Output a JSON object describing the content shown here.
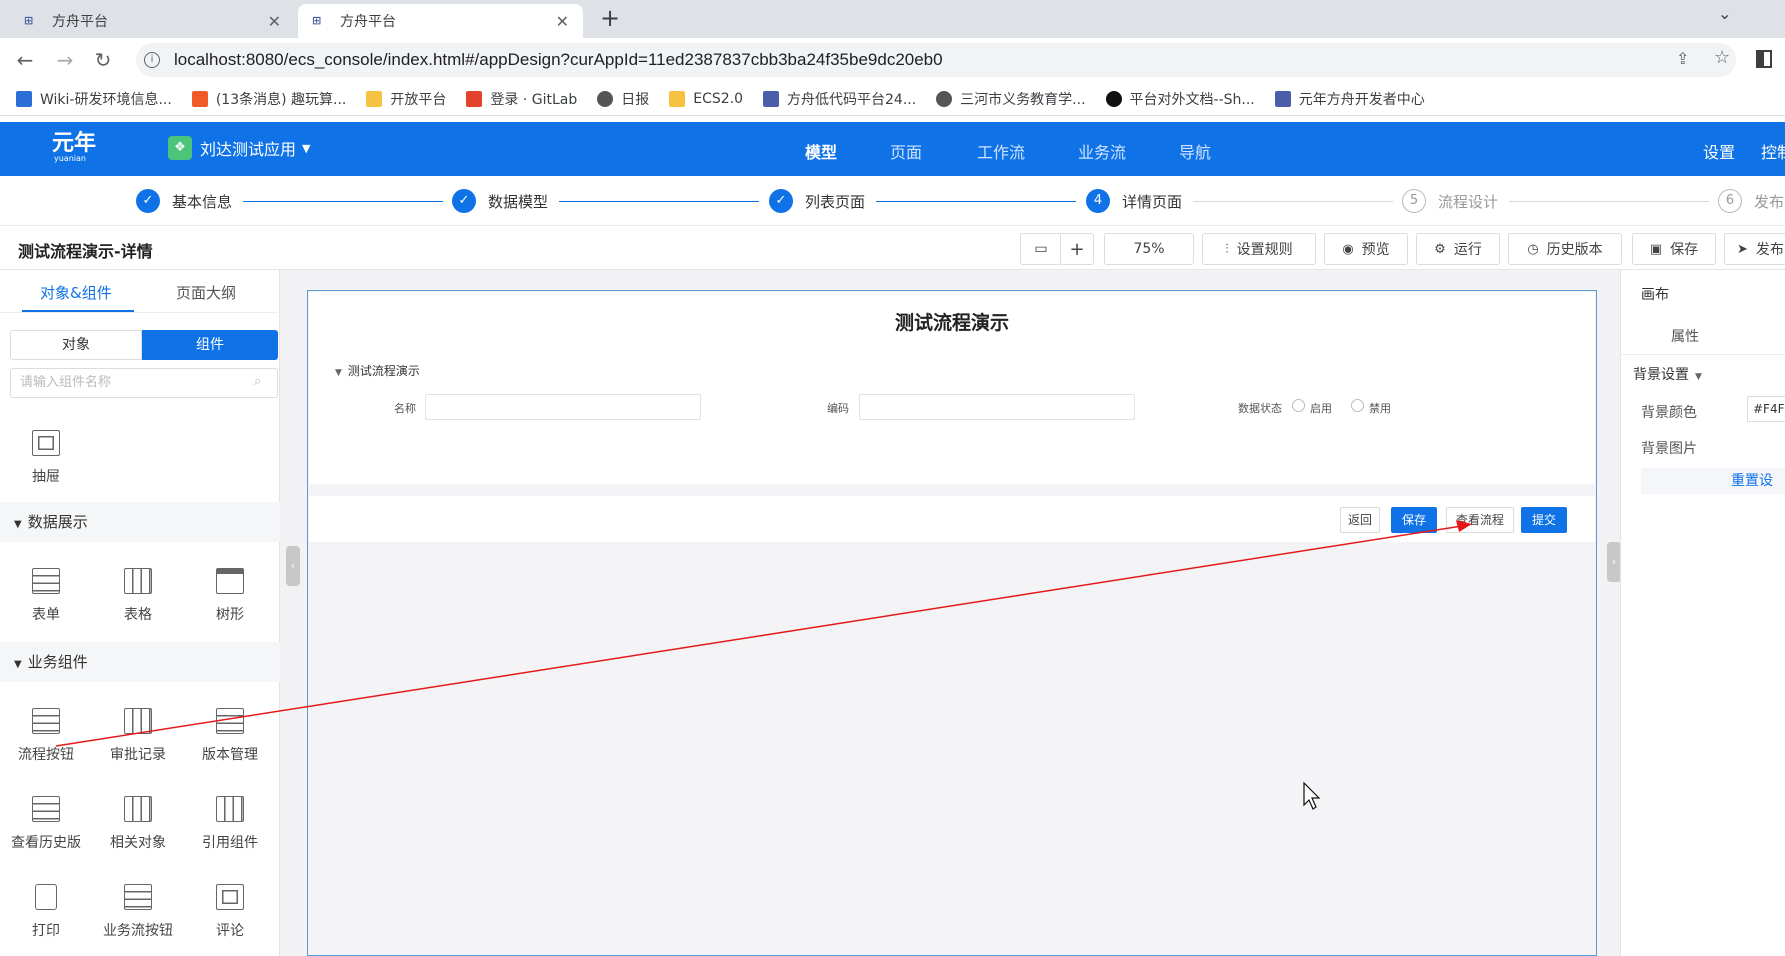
{
  "browser": {
    "tabs": [
      {
        "title": "方舟平台",
        "active": false
      },
      {
        "title": "方舟平台",
        "active": true
      }
    ],
    "url": "localhost:8080/ecs_console/index.html#/appDesign?curAppId=11ed2387837cbb3ba24f35be9dc20eb0",
    "bookmarks": [
      {
        "label": "Wiki-研发环境信息...",
        "color": "#2b6fd6"
      },
      {
        "label": "(13条消息) 趣玩算...",
        "color": "#f05a28"
      },
      {
        "label": "开放平台",
        "color": "#f5c242"
      },
      {
        "label": "登录 · GitLab",
        "color": "#e2432a"
      },
      {
        "label": "日报",
        "color": "#555555"
      },
      {
        "label": "ECS2.0",
        "color": "#f5c242"
      },
      {
        "label": "方舟低代码平台24...",
        "color": "#4a5fa8"
      },
      {
        "label": "三河市义务教育学...",
        "color": "#555555"
      },
      {
        "label": "平台对外文档--Sh...",
        "color": "#111111"
      },
      {
        "label": "元年方舟开发者中心",
        "color": "#4a5fa8"
      }
    ]
  },
  "header": {
    "logo": "元年",
    "logo_sub": "yuanian",
    "app_name": "刘达测试应用",
    "nav": [
      "模型",
      "页面",
      "工作流",
      "业务流",
      "导航"
    ],
    "active_nav": "模型",
    "settings": "设置",
    "console": "控制"
  },
  "steps": [
    {
      "num": "✓",
      "label": "基本信息",
      "state": "done"
    },
    {
      "num": "✓",
      "label": "数据模型",
      "state": "done"
    },
    {
      "num": "✓",
      "label": "列表页面",
      "state": "done"
    },
    {
      "num": "4",
      "label": "详情页面",
      "state": "current"
    },
    {
      "num": "5",
      "label": "流程设计",
      "state": "todo"
    },
    {
      "num": "6",
      "label": "发布",
      "state": "todo"
    }
  ],
  "toolbar": {
    "title": "测试流程演示-详情",
    "zoom": "75%",
    "rules": "设置规则",
    "preview": "预览",
    "run": "运行",
    "history": "历史版本",
    "save": "保存",
    "publish": "发布"
  },
  "left_panel": {
    "tabs": [
      "对象&组件",
      "页面大纲"
    ],
    "segments": [
      "对象",
      "组件"
    ],
    "search_placeholder": "请输入组件名称",
    "drawer": "抽屉",
    "section_data": "数据展示",
    "data_items": [
      "表单",
      "表格",
      "树形"
    ],
    "section_biz": "业务组件",
    "biz_items": [
      "流程按钮",
      "审批记录",
      "版本管理",
      "查看历史版",
      "相关对象",
      "引用组件",
      "打印",
      "业务流按钮",
      "评论"
    ]
  },
  "canvas": {
    "form_title": "测试流程演示",
    "group_title": "测试流程演示",
    "field_name": "名称",
    "field_code": "编码",
    "field_status": "数据状态",
    "opt_enable": "启用",
    "opt_disable": "禁用",
    "buttons": [
      "返回",
      "保存",
      "查看流程",
      "提交"
    ]
  },
  "right_panel": {
    "canvas": "画布",
    "props": "属性",
    "bg_settings": "背景设置",
    "bg_color": "背景颜色",
    "bg_color_value": "#F4F",
    "bg_image": "背景图片",
    "reset": "重置设"
  },
  "colors": {
    "brand": "#0f72e6"
  }
}
